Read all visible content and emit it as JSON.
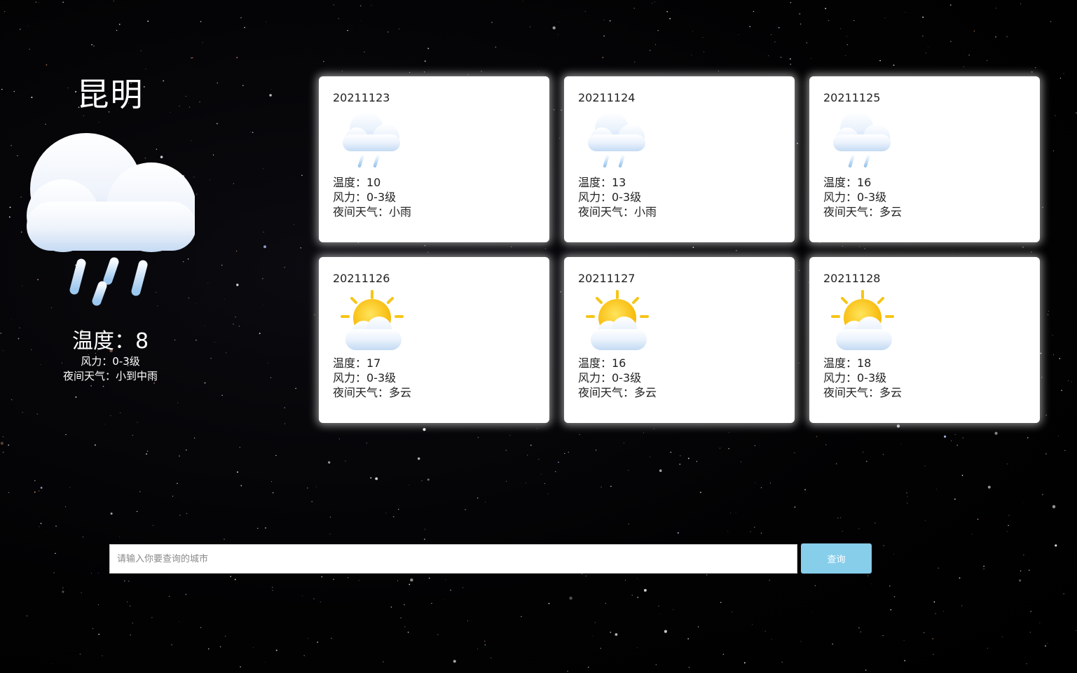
{
  "current": {
    "city": "昆明",
    "temperature": "温度：8",
    "wind": "风力：0-3级",
    "night_weather": "夜间天气：小到中雨",
    "icon": "rain-cloud-icon"
  },
  "forecast": [
    {
      "date": "20211123",
      "icon": "rain-cloud-icon",
      "temp": "温度：10",
      "wind": "风力：0-3级",
      "night": "夜间天气：小雨"
    },
    {
      "date": "20211124",
      "icon": "rain-cloud-icon",
      "temp": "温度：13",
      "wind": "风力：0-3级",
      "night": "夜间天气：小雨"
    },
    {
      "date": "20211125",
      "icon": "rain-cloud-icon",
      "temp": "温度：16",
      "wind": "风力：0-3级",
      "night": "夜间天气：多云"
    },
    {
      "date": "20211126",
      "icon": "sun-cloud-icon",
      "temp": "温度：17",
      "wind": "风力：0-3级",
      "night": "夜间天气：多云"
    },
    {
      "date": "20211127",
      "icon": "sun-cloud-icon",
      "temp": "温度：16",
      "wind": "风力：0-3级",
      "night": "夜间天气：多云"
    },
    {
      "date": "20211128",
      "icon": "sun-cloud-icon",
      "temp": "温度：18",
      "wind": "风力：0-3级",
      "night": "夜间天气：多云"
    }
  ],
  "search": {
    "placeholder": "请输入你要查询的城市",
    "value": "",
    "button_label": "查询"
  },
  "colors": {
    "background": "#000000",
    "card": "#ffffff",
    "button": "#87ceeb"
  }
}
